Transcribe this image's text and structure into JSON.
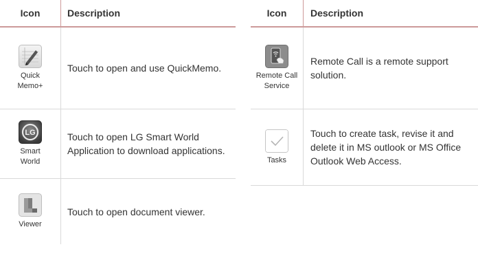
{
  "left_table": {
    "header": {
      "icon": "Icon",
      "description": "Description"
    },
    "rows": [
      {
        "icon_label": "Quick\nMemo+",
        "icon_name": "quickmemo-icon",
        "description": "Touch to open and use QuickMemo."
      },
      {
        "icon_label": "Smart\nWorld",
        "icon_name": "lg-smart-world-icon",
        "description": "Touch to open LG Smart World Application to download applications."
      },
      {
        "icon_label": "Viewer",
        "icon_name": "document-viewer-icon",
        "description": "Touch to open document viewer."
      }
    ]
  },
  "right_table": {
    "header": {
      "icon": "Icon",
      "description": "Description"
    },
    "rows": [
      {
        "icon_label": "Remote Call\nService",
        "icon_name": "remote-call-service-icon",
        "description": "Remote Call  is a remote support solution."
      },
      {
        "icon_label": "Tasks",
        "icon_name": "tasks-checkmark-icon",
        "description": "Touch to create task, revise it and delete it in MS outlook or MS Office Outlook Web Access."
      }
    ]
  },
  "colors": {
    "header_rule": "#cc9999",
    "row_rule": "#d9d9d9",
    "text": "#333333"
  }
}
